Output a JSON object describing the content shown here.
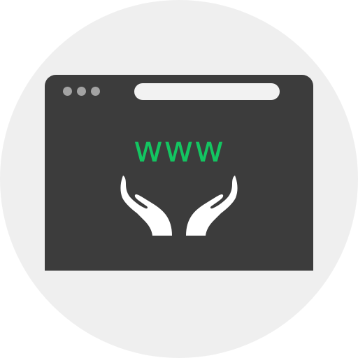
{
  "colors": {
    "background_circle": "#efefef",
    "window": "#3c3c3c",
    "window_dots": "#a3a3a3",
    "address_bar": "#f2f2f2",
    "accent": "#13c561",
    "hands": "#ffffff"
  },
  "icon": {
    "label": "www",
    "symbol": "hands-holding-icon"
  }
}
